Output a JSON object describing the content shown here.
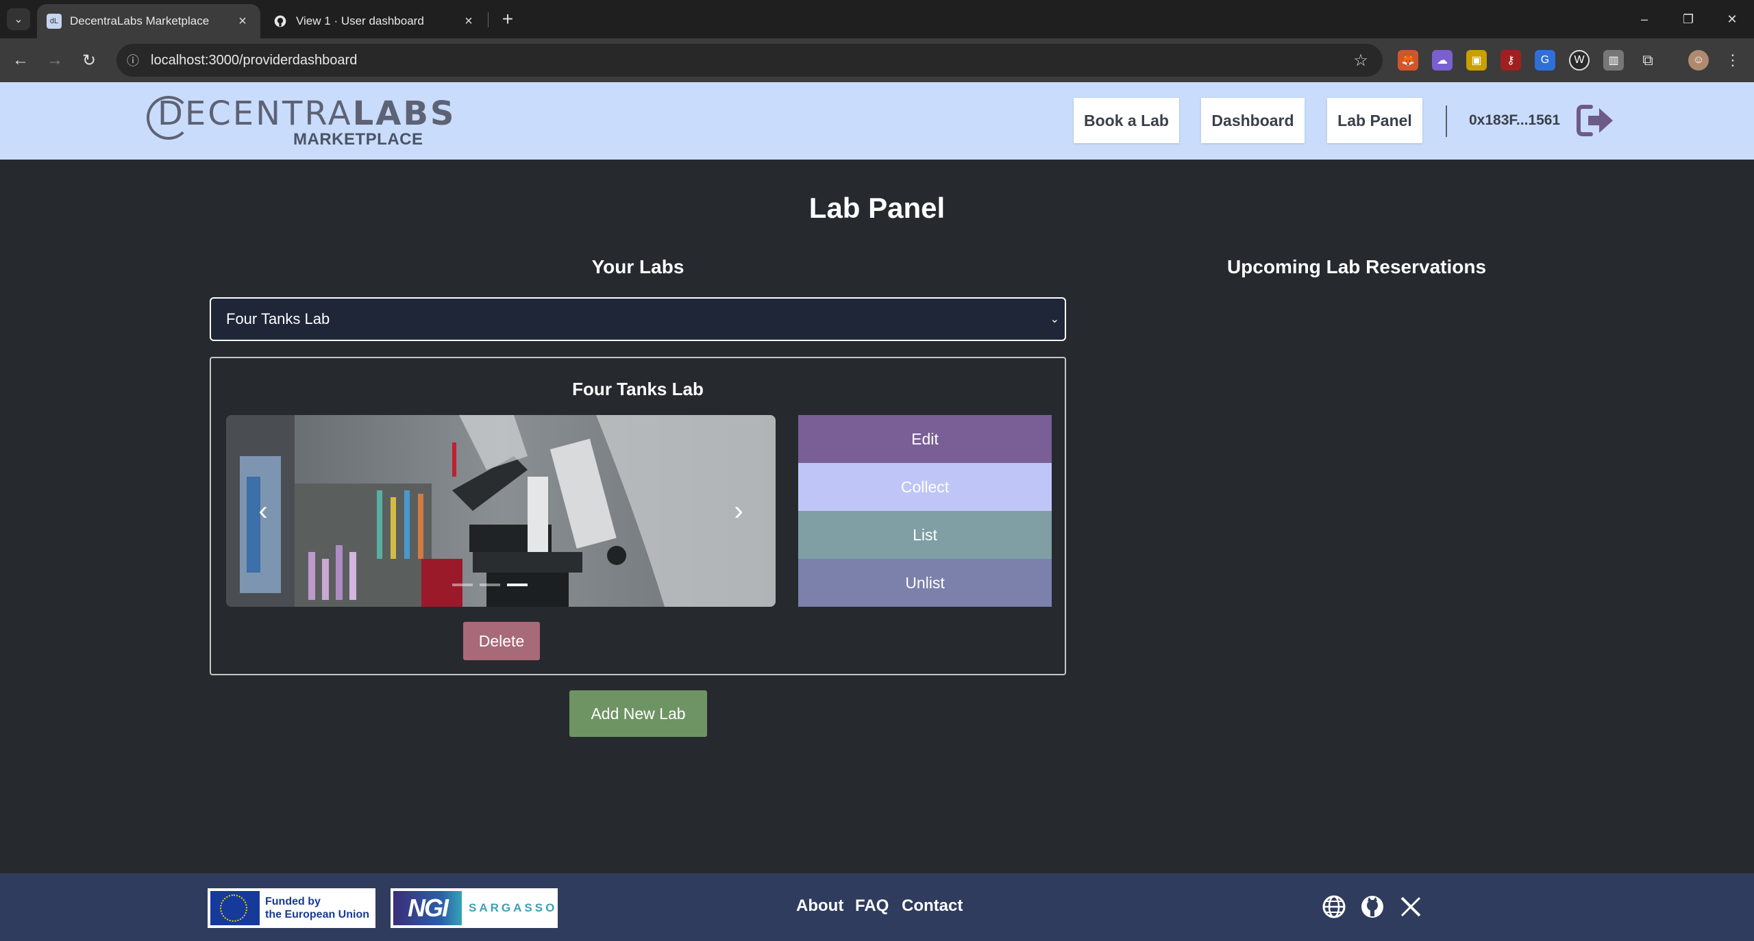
{
  "browser": {
    "tabs": [
      {
        "title": "DecentraLabs Marketplace",
        "favicon": "decentralabs-favicon",
        "active": true
      },
      {
        "title": "View 1 · User dashboard",
        "favicon": "github-favicon",
        "active": false
      }
    ],
    "url": "localhost:3000/providerdashboard"
  },
  "header": {
    "logo": {
      "main_left": "DECENTRA",
      "main_right": "LABS",
      "sub": "MARKETPLACE"
    },
    "nav": [
      {
        "label": "Book a Lab"
      },
      {
        "label": "Dashboard"
      },
      {
        "label": "Lab Panel"
      }
    ],
    "wallet": "0x183F...1561"
  },
  "main": {
    "title": "Lab Panel",
    "your_labs_title": "Your Labs",
    "reservations_title": "Upcoming Lab Reservations",
    "selected_lab": "Four Tanks Lab",
    "card": {
      "title": "Four Tanks Lab",
      "actions": [
        {
          "label": "Edit",
          "color": "#7a5f96"
        },
        {
          "label": "Collect",
          "color": "#bfc6f7"
        },
        {
          "label": "List",
          "color": "#7f9fa4"
        },
        {
          "label": "Unlist",
          "color": "#7b81ab"
        }
      ],
      "delete_label": "Delete"
    },
    "add_label": "Add New Lab"
  },
  "footer": {
    "eu_text_1": "Funded by",
    "eu_text_2": "the European Union",
    "ngi_badge": "NGI",
    "ngi_text": "SARGASSO",
    "links": [
      {
        "label": "About"
      },
      {
        "label": "FAQ"
      },
      {
        "label": "Contact"
      }
    ],
    "social_icons": [
      "globe-icon",
      "github-icon",
      "x-icon"
    ]
  },
  "colors": {
    "header_bg": "#c9dcfb",
    "page_bg": "#262a2e",
    "footer_bg": "#2f3c5e",
    "add_button": "#6f9464",
    "delete_button": "#a86a78"
  }
}
